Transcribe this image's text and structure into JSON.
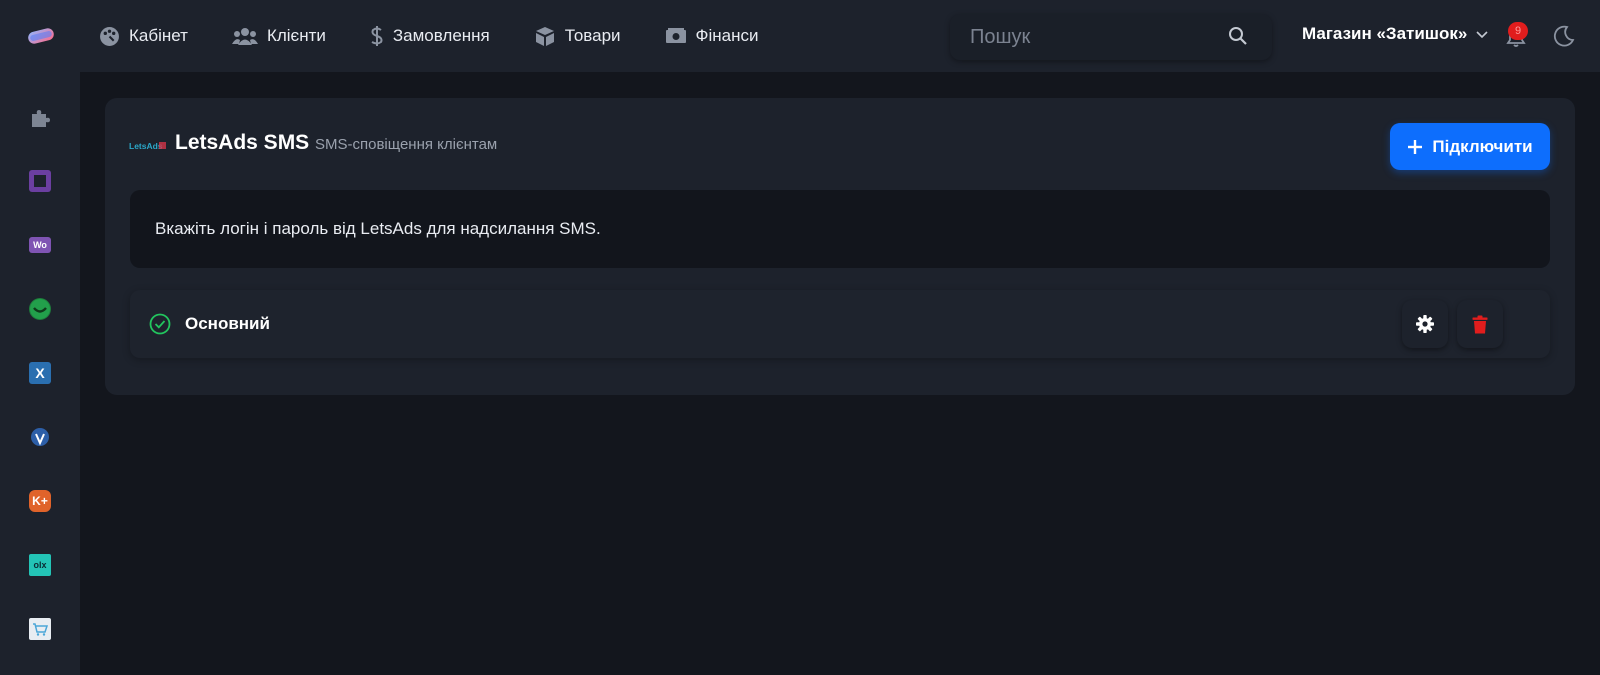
{
  "nav": {
    "items": [
      {
        "label": "Кабінет",
        "icon": "palette-icon"
      },
      {
        "label": "Клієнти",
        "icon": "users-icon"
      },
      {
        "label": "Замовлення",
        "icon": "dollar-icon"
      },
      {
        "label": "Товари",
        "icon": "box-icon"
      },
      {
        "label": "Фінанси",
        "icon": "money-icon"
      }
    ]
  },
  "search": {
    "placeholder": "Пошук"
  },
  "store": {
    "label": "Магазин «Затишок»"
  },
  "notifications": {
    "count": "9"
  },
  "sidebar": {
    "icons": [
      "puzzle-icon",
      "square-app-icon",
      "woo-icon",
      "smile-app-icon",
      "x-app-icon",
      "drop-app-icon",
      "k-plus-icon",
      "olx-icon",
      "cart-app-icon"
    ]
  },
  "integration": {
    "logo_text": "LetsAds",
    "title": "LetsAds SMS",
    "subtitle": "SMS-сповіщення клієнтам",
    "connect_label": "Підключити",
    "info_text": "Вкажіть логін і пароль від LetsAds для надсилання SMS.",
    "account": {
      "name": "Основний",
      "status": "active"
    }
  },
  "colors": {
    "accent": "#0d6efd",
    "success": "#22c55e",
    "danger": "#e11d1d",
    "background": "#13161d",
    "panel": "#1d222c"
  }
}
